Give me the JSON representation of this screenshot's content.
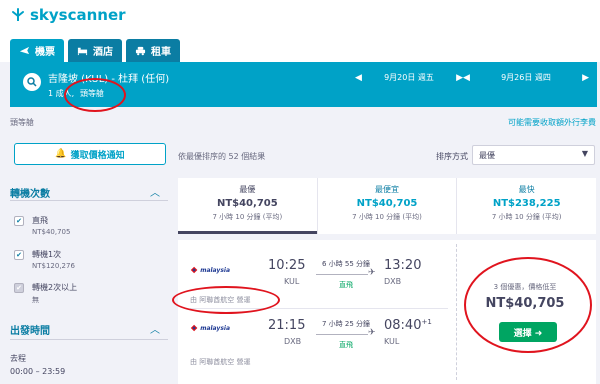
{
  "header": {
    "brand": "skyscanner"
  },
  "nav": {
    "tabs": [
      {
        "label": "機票",
        "icon": "plane-icon"
      },
      {
        "label": "酒店",
        "icon": "bed-icon"
      },
      {
        "label": "租車",
        "icon": "car-icon"
      }
    ]
  },
  "search": {
    "route": "吉隆坡 (KUL) - 杜拜 (任何)",
    "passengers": "1 成人,",
    "cabin": "頭等艙",
    "depart_date": "9月20日 週五",
    "return_date": "9月26日 週四"
  },
  "filters_bar": {
    "cabin_label": "頭等艙",
    "fees_link": "可能需要收取額外行李費"
  },
  "sidebar": {
    "price_alert_label": "獲取價格通知",
    "stops_title": "轉機次數",
    "stops": [
      {
        "label": "直飛",
        "price": "NT$40,705",
        "checked": true
      },
      {
        "label": "轉機1次",
        "price": "NT$120,276",
        "checked": true
      },
      {
        "label": "轉機2次以上",
        "price": "無",
        "checked": true
      }
    ],
    "departure_title": "出發時間",
    "outbound_label": "去程",
    "outbound_range": "00:00 – 23:59"
  },
  "results": {
    "count_text": "依最優排序的 52 個結果",
    "sort_label": "排序方式",
    "sort_value": "最優",
    "sort_tabs": [
      {
        "title": "最優",
        "price": "NT$40,705",
        "duration": "7 小時 10 分鐘 (平均)",
        "active": true
      },
      {
        "title": "最便宜",
        "price": "NT$40,705",
        "duration": "7 小時 10 分鐘 (平均)",
        "active": false
      },
      {
        "title": "最快",
        "price": "NT$238,225",
        "duration": "7 小時 10 分鐘 (平均)",
        "active": false
      }
    ]
  },
  "flight_card": {
    "airline": "malaysia",
    "outbound": {
      "depart_time": "10:25",
      "depart_code": "KUL",
      "arrive_time": "13:20",
      "arrive_code": "DXB",
      "duration": "6 小時 55 分鐘",
      "stops": "直飛",
      "operated_by": "由 阿聯酋航空 營運"
    },
    "inbound": {
      "depart_time": "21:15",
      "depart_code": "DXB",
      "arrive_time": "08:40",
      "arrive_day": "+1",
      "arrive_code": "KUL",
      "duration": "7 小時 25 分鐘",
      "stops": "直飛",
      "operated_by": "由 阿聯酋航空 營運"
    },
    "deals_text": "3 個優惠，價格低至",
    "price": "NT$40,705",
    "select_label": "選擇 ➜"
  },
  "colors": {
    "accent": "#00a2c7",
    "dark": "#0b7da3",
    "green": "#00a562",
    "annotation": "#e0141e"
  }
}
